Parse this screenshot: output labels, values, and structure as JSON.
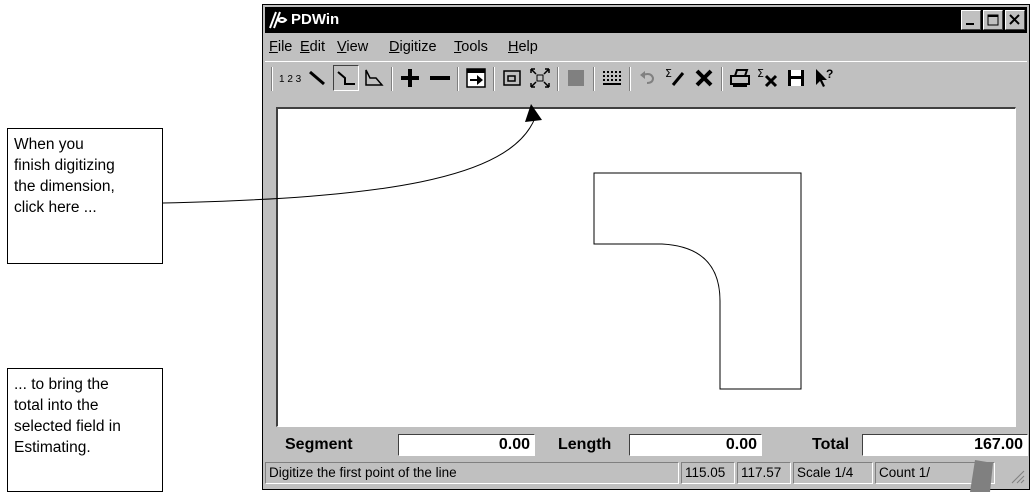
{
  "callouts": {
    "top": [
      "When you",
      "finish digitizing",
      "the dimension,",
      "click here ..."
    ],
    "bottom": [
      "... to bring the",
      "total into the",
      "selected field in",
      "Estimating."
    ]
  },
  "window": {
    "title": "PDWin",
    "controls": [
      "minimize-icon",
      "maximize-icon",
      "close-icon"
    ]
  },
  "menu": {
    "items": [
      {
        "first": "F",
        "rest": "ile"
      },
      {
        "first": "E",
        "rest": "dit"
      },
      {
        "first": "V",
        "rest": "iew"
      },
      {
        "first": "D",
        "rest": "igitize"
      },
      {
        "first": "T",
        "rest": "ools"
      },
      {
        "first": "H",
        "rest": "elp"
      }
    ]
  },
  "toolbar": {
    "count_label": "1 2 3",
    "icons": [
      "count-icon",
      "line-icon",
      "polyline-icon",
      "area-icon",
      "plus-icon",
      "minus-icon",
      "send-total-icon",
      "window-icon",
      "zoom-extents-icon",
      "fill-icon",
      "grid-icon",
      "undo-icon",
      "sum-pen-icon",
      "delete-icon",
      "print-icon",
      "clear-sum-icon",
      "save-icon",
      "help-pointer-icon"
    ]
  },
  "fields": {
    "segment_label": "Segment",
    "segment_value": "0.00",
    "length_label": "Length",
    "length_value": "0.00",
    "total_label": "Total",
    "total_value": "167.00"
  },
  "status": {
    "message": "Digitize the first point of the line",
    "coord_x": "115.05",
    "coord_y": "117.57",
    "scale": "Scale 1/4",
    "count": "Count 1/"
  }
}
